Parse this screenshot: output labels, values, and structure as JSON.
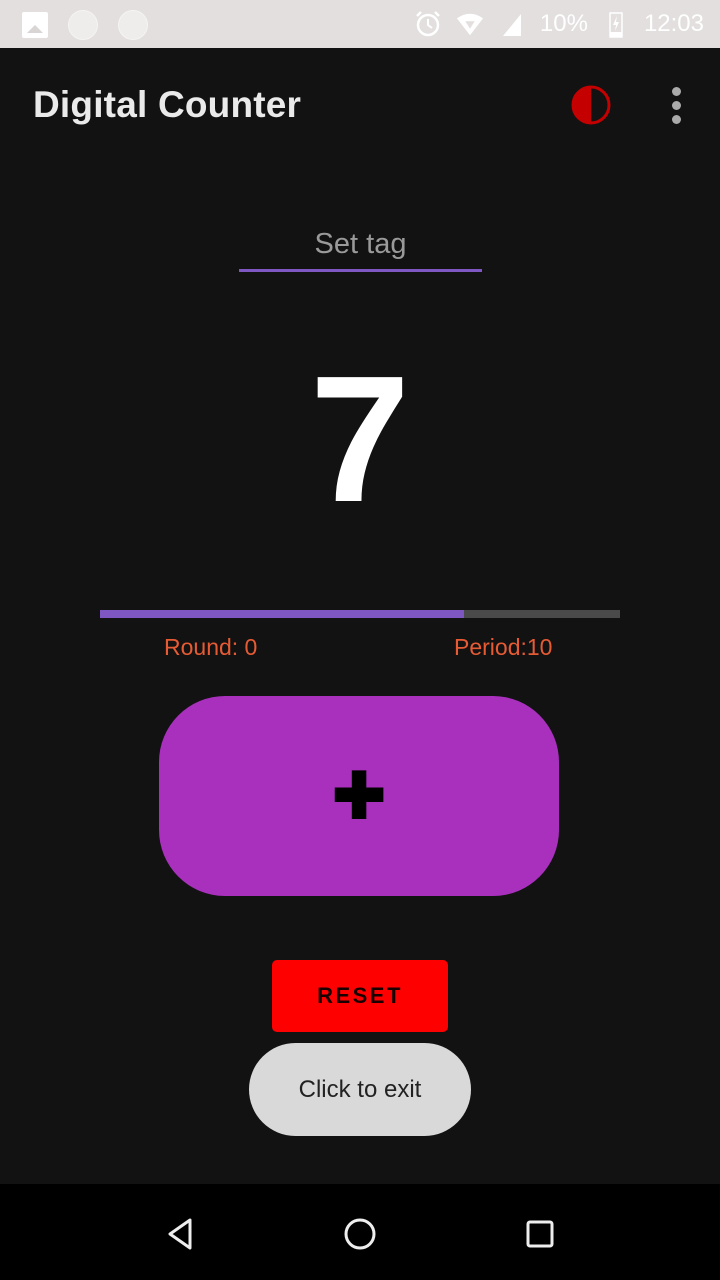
{
  "status_bar": {
    "battery": "10%",
    "time": "12:03",
    "left_icons": [
      "image-notification-icon",
      "circle-notification-icon",
      "circle-notification-icon"
    ],
    "right_icons": [
      "alarm-icon",
      "wifi-icon",
      "cell-signal-icon",
      "battery-charging-icon"
    ]
  },
  "app_bar": {
    "title": "Digital Counter",
    "theme_icon": "contrast-icon",
    "menu_icon": "more-vert-icon",
    "theme_color": "#c40000"
  },
  "tag": {
    "placeholder": "Set tag",
    "value": ""
  },
  "counter": {
    "value": "7",
    "progress_fraction": 0.7,
    "round_label": "Round: 0",
    "period_label": "Period:10"
  },
  "buttons": {
    "increment_label": "✚",
    "reset_label": "RESET"
  },
  "toast": {
    "text": "Click to exit"
  },
  "colors": {
    "background": "#121212",
    "accent": "#7e57c2",
    "increment": "#a830bd",
    "reset": "#ff0000",
    "labels": "#e65b34"
  },
  "nav_bar": {
    "icons": [
      "back-icon",
      "home-icon",
      "recents-icon"
    ]
  }
}
